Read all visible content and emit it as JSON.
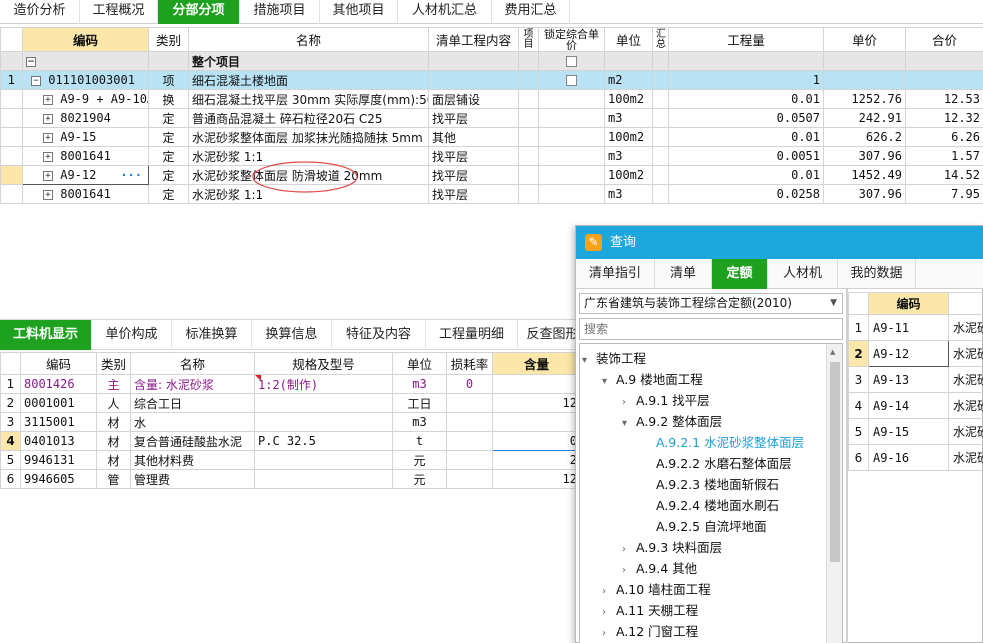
{
  "top_tabs": [
    "造价分析",
    "工程概况",
    "分部分项",
    "措施项目",
    "其他项目",
    "人材机汇总",
    "费用汇总"
  ],
  "top_active": "分部分项",
  "upper_grid": {
    "headers": {
      "code": "编码",
      "type": "类别",
      "name": "名称",
      "content": "清单工程内容",
      "proj": "项目",
      "lock": "锁定综合单价",
      "unit": "单位",
      "summary": "汇总",
      "qty": "工程量",
      "price": "单价",
      "total": "合价"
    },
    "root_label": "整个项目",
    "rows": [
      {
        "num": "1",
        "expander": "−",
        "code": "011101003001",
        "type": "项",
        "name": "细石混凝土楼地面",
        "content": "",
        "unit": "m2",
        "qty": "1",
        "price": "",
        "total": ""
      },
      {
        "num": "",
        "expander": "+",
        "code": "A9-9 + A9-10…",
        "type": "换",
        "name": "细石混凝土找平层 30mm  实际厚度(mm):50",
        "content": "面层铺设",
        "unit": "100m2",
        "qty": "0.01",
        "price": "1252.76",
        "total": "12.53"
      },
      {
        "num": "",
        "expander": "+",
        "code": "8021904",
        "type": "定",
        "name": "普通商品混凝土 碎石粒径20石 C25",
        "content": "找平层",
        "unit": "m3",
        "qty": "0.0507",
        "price": "242.91",
        "total": "12.32"
      },
      {
        "num": "",
        "expander": "+",
        "code": "A9-15",
        "type": "定",
        "name": "水泥砂浆整体面层 加浆抹光随捣随抹 5mm",
        "content": "其他",
        "unit": "100m2",
        "qty": "0.01",
        "price": "626.2",
        "total": "6.26"
      },
      {
        "num": "",
        "expander": "+",
        "code": "8001641",
        "type": "定",
        "name": "水泥砂浆 1:1",
        "content": "找平层",
        "unit": "m3",
        "qty": "0.0051",
        "price": "307.96",
        "total": "1.57"
      },
      {
        "num": "",
        "expander": "+",
        "code": "A9-12",
        "more": "···",
        "type": "定",
        "name": "水泥砂浆整体面层 防滑坡道 20mm",
        "content": "找平层",
        "unit": "100m2",
        "qty": "0.01",
        "price": "1452.49",
        "total": "14.52"
      },
      {
        "num": "",
        "expander": "+",
        "code": "8001641",
        "type": "定",
        "name": "水泥砂浆 1:1",
        "content": "找平层",
        "unit": "m3",
        "qty": "0.0258",
        "price": "307.96",
        "total": "7.95"
      }
    ]
  },
  "bottom_tabs": [
    "工料机显示",
    "单价构成",
    "标准换算",
    "换算信息",
    "特征及内容",
    "工程量明细",
    "反查图形"
  ],
  "bottom_active": "工料机显示",
  "lower_grid": {
    "headers": {
      "code": "编码",
      "type": "类别",
      "name": "名称",
      "spec": "规格及型号",
      "unit": "单位",
      "loss": "损耗率",
      "qty": "含量"
    },
    "rows": [
      {
        "num": "1",
        "code": "8001426",
        "type": "主",
        "name": "含量: 水泥砂浆",
        "spec": "1:2(制作)",
        "unit": "m3",
        "loss": "0",
        "qty": ""
      },
      {
        "num": "2",
        "code": "0001001",
        "type": "人",
        "name": "综合工日",
        "spec": "",
        "unit": "工日",
        "loss": "",
        "qty": "12"
      },
      {
        "num": "3",
        "code": "3115001",
        "type": "材",
        "name": "水",
        "spec": "",
        "unit": "m3",
        "loss": "",
        "qty": ""
      },
      {
        "num": "4",
        "code": "0401013",
        "type": "材",
        "name": "复合普通硅酸盐水泥",
        "spec": "P.C 32.5",
        "unit": "t",
        "loss": "",
        "qty": "0"
      },
      {
        "num": "5",
        "code": "9946131",
        "type": "材",
        "name": "其他材料费",
        "spec": "",
        "unit": "元",
        "loss": "",
        "qty": "2"
      },
      {
        "num": "6",
        "code": "9946605",
        "type": "管",
        "name": "管理费",
        "spec": "",
        "unit": "元",
        "loss": "",
        "qty": "12"
      }
    ]
  },
  "dialog": {
    "title": "查询",
    "tabs": [
      "清单指引",
      "清单",
      "定额",
      "人材机",
      "我的数据"
    ],
    "active_tab": "定额",
    "dropdown": "广东省建筑与装饰工程综合定额(2010)",
    "search_placeholder": "搜索",
    "tree": [
      {
        "label": "装饰工程",
        "arrow": "▾",
        "level": 0
      },
      {
        "label": "A.9 楼地面工程",
        "arrow": "▾",
        "level": 1
      },
      {
        "label": "A.9.1 找平层",
        "arrow": "›",
        "level": 2
      },
      {
        "label": "A.9.2 整体面层",
        "arrow": "▾",
        "level": 2
      },
      {
        "label": "A.9.2.1 水泥砂浆整体面层",
        "arrow": "",
        "level": 3,
        "selected": true
      },
      {
        "label": "A.9.2.2 水磨石整体面层",
        "arrow": "",
        "level": 3
      },
      {
        "label": "A.9.2.3 楼地面斩假石",
        "arrow": "",
        "level": 3
      },
      {
        "label": "A.9.2.4 楼地面水刷石",
        "arrow": "",
        "level": 3
      },
      {
        "label": "A.9.2.5 自流坪地面",
        "arrow": "",
        "level": 3
      },
      {
        "label": "A.9.3 块料面层",
        "arrow": "›",
        "level": 2
      },
      {
        "label": "A.9.4 其他",
        "arrow": "›",
        "level": 2
      },
      {
        "label": "A.10 墙柱面工程",
        "arrow": "›",
        "level": 1
      },
      {
        "label": "A.11 天棚工程",
        "arrow": "›",
        "level": 1
      },
      {
        "label": "A.12 门窗工程",
        "arrow": "›",
        "level": 1
      }
    ],
    "result_header": "编码",
    "results": [
      {
        "num": "1",
        "code": "A9-11",
        "name": "水泥砂"
      },
      {
        "num": "2",
        "code": "A9-12",
        "name": "水泥砂"
      },
      {
        "num": "3",
        "code": "A9-13",
        "name": "水泥砂"
      },
      {
        "num": "4",
        "code": "A9-14",
        "name": "水泥砂"
      },
      {
        "num": "5",
        "code": "A9-15",
        "name": "水泥砂"
      },
      {
        "num": "6",
        "code": "A9-16",
        "name": "水泥砂"
      }
    ]
  },
  "colors": {
    "accent_green": "#1ea11e",
    "dialog_blue": "#1ea7dd",
    "highlight_row": "#b9e3f5",
    "material_purple": "#8a1a8a"
  }
}
